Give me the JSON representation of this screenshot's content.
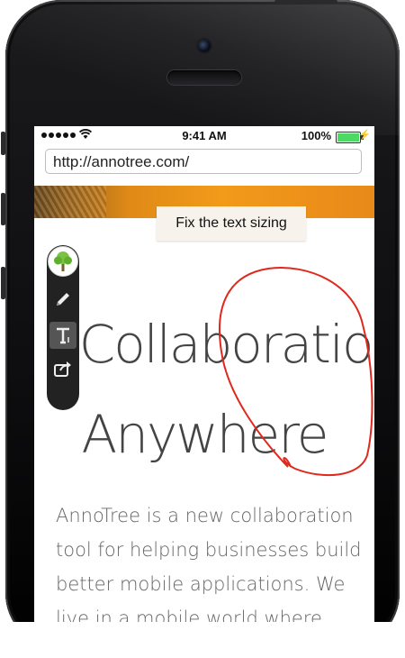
{
  "status_bar": {
    "time": "9:41 AM",
    "battery_percent": "100%",
    "signal_icon": "signal-dots-icon",
    "wifi_icon": "wifi-icon",
    "battery_icon": "battery-icon",
    "charging_icon": "charging-bolt-icon",
    "battery_color": "#4cd964"
  },
  "browser": {
    "url": "http://annotree.com/"
  },
  "annotation": {
    "comment_text": "Fix the text sizing",
    "stroke_color": "#e0281c"
  },
  "toolbar": {
    "tools": [
      {
        "icon": "annotree-logo-icon"
      },
      {
        "icon": "pencil-icon"
      },
      {
        "icon": "text-tool-icon",
        "active": true
      },
      {
        "icon": "share-icon"
      }
    ]
  },
  "page": {
    "heading_line1": "Collaboration",
    "heading_line2": "Anywhere",
    "paragraph": "AnnoTree is a new collaboration tool for helping businesses build better mobile applications. We live in a mobile world where"
  }
}
